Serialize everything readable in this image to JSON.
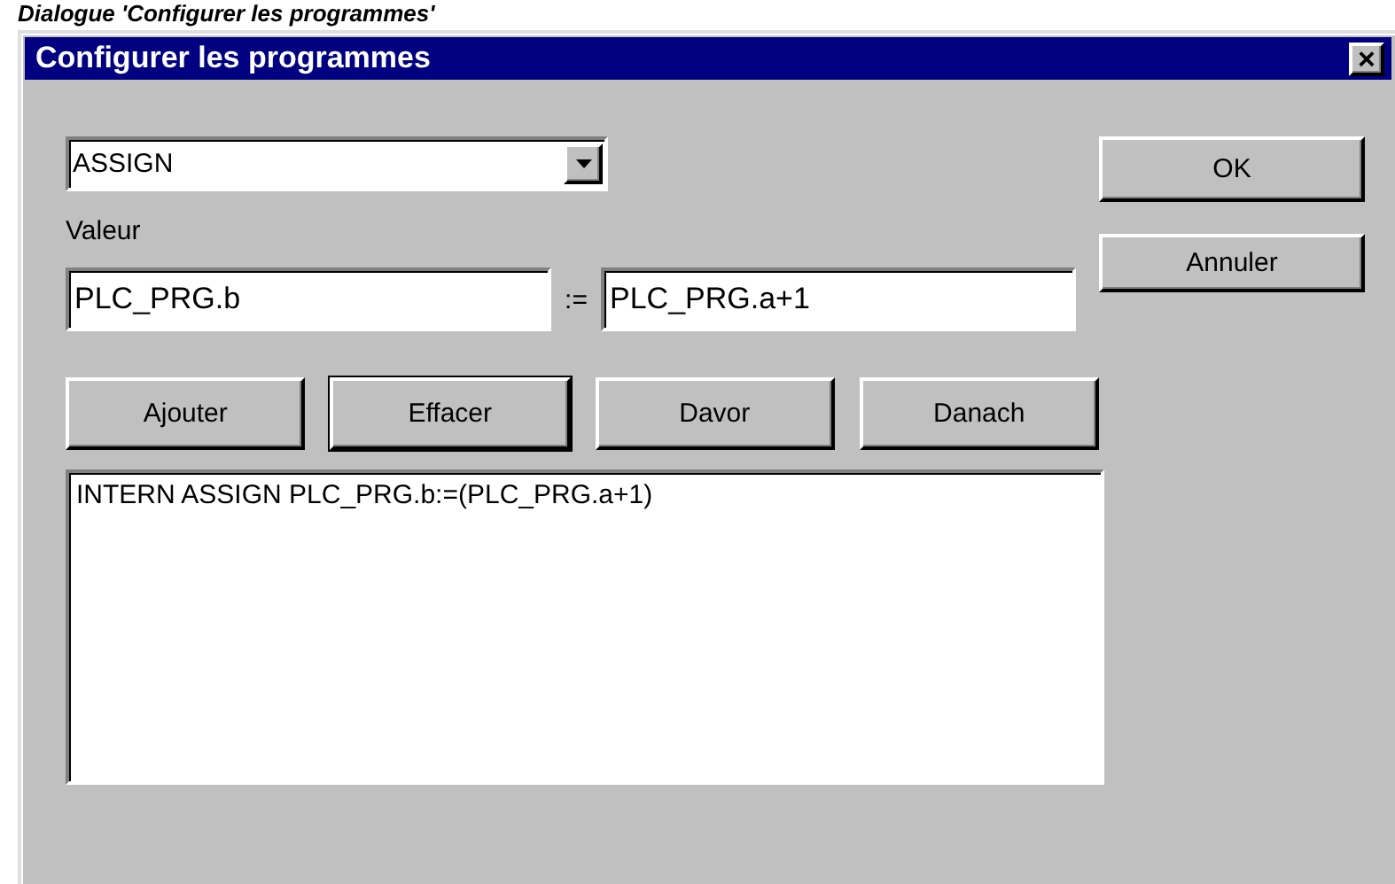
{
  "caption": "Dialogue 'Configurer les programmes'",
  "window": {
    "title": "Configurer les programmes",
    "close": "×"
  },
  "program_select": {
    "value": "ASSIGN"
  },
  "value_label": "Valeur",
  "target_field": {
    "value": "PLC_PRG.b"
  },
  "assign_operator": ":=",
  "expression_field": {
    "value": "PLC_PRG.a+1"
  },
  "dialog_buttons": [
    {
      "label": "OK",
      "default": false
    },
    {
      "label": "Annuler",
      "default": false
    }
  ],
  "action_buttons": [
    {
      "label": "Ajouter",
      "default": false
    },
    {
      "label": "Effacer",
      "default": true
    },
    {
      "label": "Davor",
      "default": false
    },
    {
      "label": "Danach",
      "default": false
    }
  ],
  "program_list": {
    "items": [
      {
        "text": "INTERN ASSIGN PLC_PRG.b:=(PLC_PRG.a+1)",
        "selected": false
      }
    ]
  }
}
